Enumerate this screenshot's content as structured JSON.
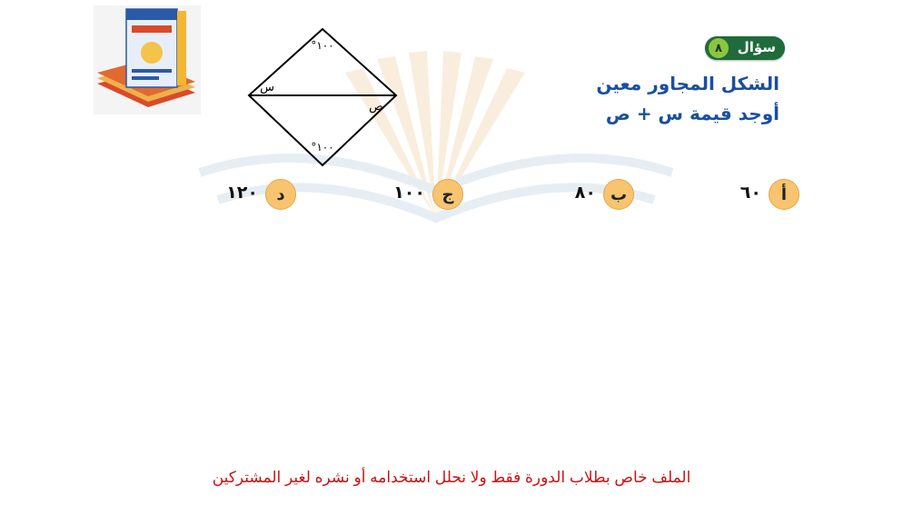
{
  "question": {
    "badge_label": "سؤال",
    "number": "٨",
    "line1": "الشكل المجاور معين",
    "line2": "أوجد قيمة س + ص"
  },
  "figure": {
    "top_angle": "١٠٠°",
    "bottom_angle": "١٠٠°",
    "label_x": "س",
    "label_y": "ص"
  },
  "options": [
    {
      "letter": "أ",
      "value": "٦٠"
    },
    {
      "letter": "ب",
      "value": "٨٠"
    },
    {
      "letter": "ج",
      "value": "١٠٠"
    },
    {
      "letter": "د",
      "value": "١٢٠"
    }
  ],
  "footer": "الملف خاص بطلاب الدورة فقط ولا نحلل استخدامه أو نشره لغير المشتركين",
  "colors": {
    "question_text": "#1a4fa0",
    "badge": "#1f6b3b",
    "badge_number": "#8cc63f",
    "option_circle": "#f8c46f",
    "footer_text": "#cc1111"
  }
}
